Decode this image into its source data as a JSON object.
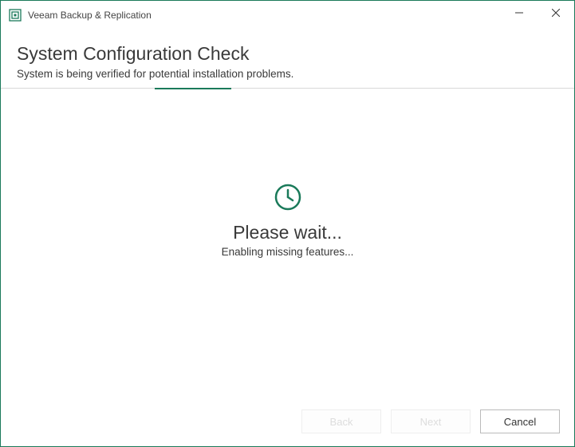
{
  "window": {
    "title": "Veeam Backup & Replication"
  },
  "header": {
    "title": "System Configuration Check",
    "subtitle": "System is being verified for potential installation problems."
  },
  "content": {
    "wait_title": "Please wait...",
    "wait_subtitle": "Enabling missing features..."
  },
  "footer": {
    "back_label": "Back",
    "next_label": "Next",
    "cancel_label": "Cancel"
  },
  "colors": {
    "accent": "#1a7a5a"
  }
}
